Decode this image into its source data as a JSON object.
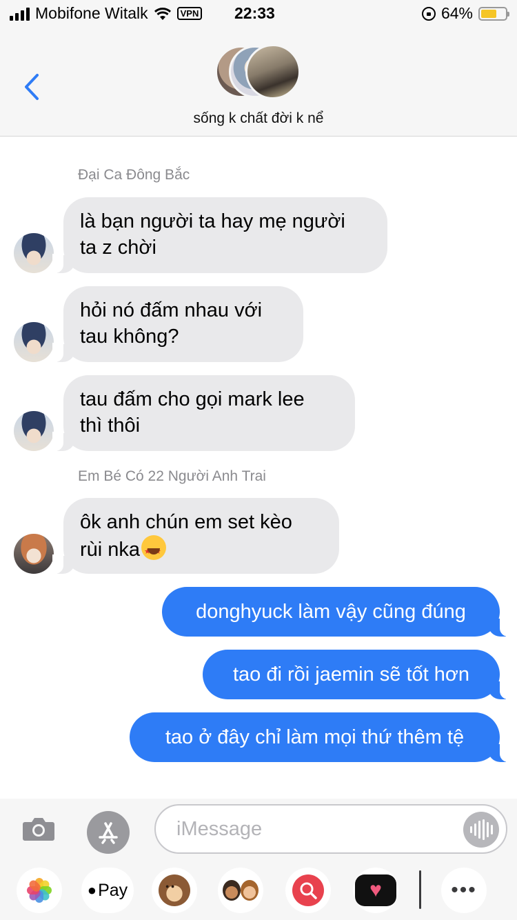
{
  "status_bar": {
    "carrier": "Mobifone Witalk",
    "vpn": "VPN",
    "time": "22:33",
    "battery": "64%",
    "battery_level": 0.64
  },
  "header": {
    "title": "sống k chất đời k nể"
  },
  "messages": [
    {
      "type": "sender",
      "text": "Đại Ca Đông Bắc"
    },
    {
      "type": "incoming",
      "lines": [
        "là bạn người ta hay mẹ người",
        "ta z chời"
      ]
    },
    {
      "type": "incoming",
      "lines": [
        "hỏi nó đấm nhau với",
        "tau không?"
      ]
    },
    {
      "type": "incoming",
      "lines": [
        "tau đấm cho gọi mark lee",
        "thì thôi"
      ]
    },
    {
      "type": "sender",
      "text": "Em Bé Có 22 Người Anh Trai"
    },
    {
      "type": "incoming",
      "lines": [
        "ôk anh chún em set kèo",
        "rùi nka"
      ],
      "emoji": "star-struck-emoji"
    },
    {
      "type": "outgoing",
      "text": "donghyuck làm vậy cũng đúng"
    },
    {
      "type": "outgoing",
      "text": "tao đi rồi jaemin sẽ tốt hơn"
    },
    {
      "type": "outgoing",
      "text": "tao ở đây chỉ làm mọi thứ thêm tệ"
    }
  ],
  "compose": {
    "placeholder": "iMessage"
  },
  "app_drawer": {
    "apple_pay": "Pay",
    "apps": [
      "photos-icon",
      "apple-pay-icon",
      "animoji-icon",
      "memoji-icon",
      "image-search-icon",
      "digital-touch-icon",
      "more-icon"
    ]
  },
  "colors": {
    "outgoing_bubble": "#2e7cf6",
    "incoming_bubble": "#e9e9eb",
    "back_chevron": "#2e7cf6",
    "battery": "#f5c526"
  }
}
